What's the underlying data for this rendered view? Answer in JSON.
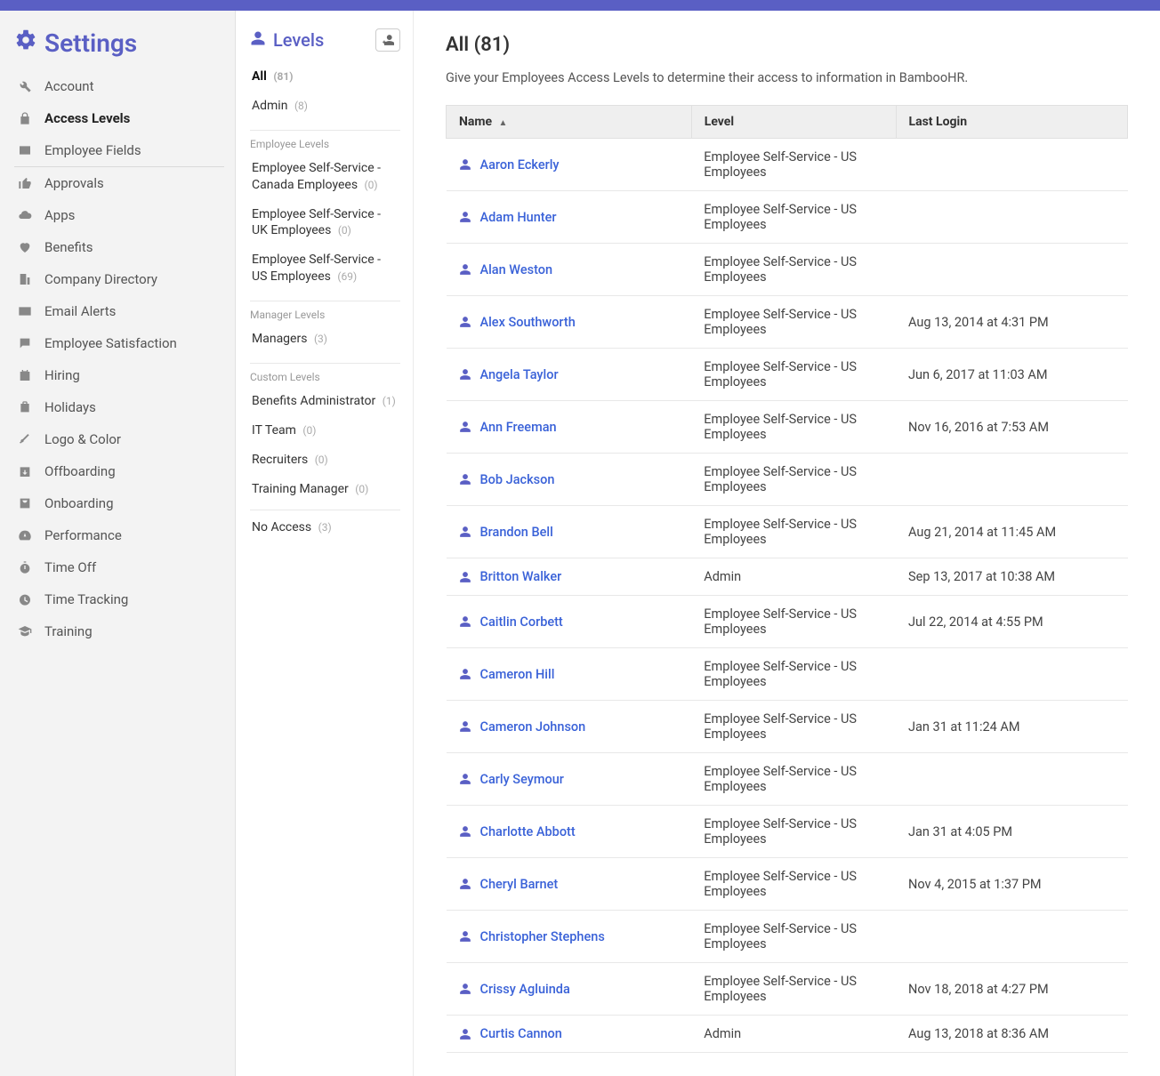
{
  "sidebar": {
    "title": "Settings",
    "items": [
      {
        "label": "Account",
        "icon": "wrench-icon"
      },
      {
        "label": "Access Levels",
        "icon": "lock-icon",
        "active": true
      },
      {
        "label": "Employee Fields",
        "icon": "id-card-icon"
      },
      {
        "label": "Approvals",
        "icon": "thumbs-up-icon",
        "borderTop": true
      },
      {
        "label": "Apps",
        "icon": "cloud-icon"
      },
      {
        "label": "Benefits",
        "icon": "heart-icon"
      },
      {
        "label": "Company Directory",
        "icon": "building-icon"
      },
      {
        "label": "Email Alerts",
        "icon": "mail-alert-icon"
      },
      {
        "label": "Employee Satisfaction",
        "icon": "chat-icon"
      },
      {
        "label": "Hiring",
        "icon": "clipboard-icon"
      },
      {
        "label": "Holidays",
        "icon": "luggage-icon"
      },
      {
        "label": "Logo & Color",
        "icon": "brush-icon"
      },
      {
        "label": "Offboarding",
        "icon": "calendar-out-icon"
      },
      {
        "label": "Onboarding",
        "icon": "badge-icon"
      },
      {
        "label": "Performance",
        "icon": "gauge-icon"
      },
      {
        "label": "Time Off",
        "icon": "stopwatch-icon"
      },
      {
        "label": "Time Tracking",
        "icon": "timer-icon"
      },
      {
        "label": "Training",
        "icon": "graduation-icon"
      }
    ]
  },
  "levels": {
    "title": "Levels",
    "top": [
      {
        "label": "All",
        "count": "(81)",
        "active": true
      },
      {
        "label": "Admin",
        "count": "(8)"
      }
    ],
    "sections": [
      {
        "title": "Employee Levels",
        "items": [
          {
            "label": "Employee Self-Service - Canada Employees",
            "count": "(0)"
          },
          {
            "label": "Employee Self-Service - UK Employees",
            "count": "(0)"
          },
          {
            "label": "Employee Self-Service - US Employees",
            "count": "(69)"
          }
        ]
      },
      {
        "title": "Manager Levels",
        "items": [
          {
            "label": "Managers",
            "count": "(3)"
          }
        ]
      },
      {
        "title": "Custom Levels",
        "items": [
          {
            "label": "Benefits Administrator",
            "count": "(1)"
          },
          {
            "label": "IT Team",
            "count": "(0)"
          },
          {
            "label": "Recruiters",
            "count": "(0)"
          },
          {
            "label": "Training Manager",
            "count": "(0)"
          }
        ]
      }
    ],
    "bottom": [
      {
        "label": "No Access",
        "count": "(3)"
      }
    ]
  },
  "main": {
    "title": "All (81)",
    "description": "Give your Employees Access Levels to determine their access to information in BambooHR.",
    "columns": {
      "name": "Name",
      "level": "Level",
      "lastLogin": "Last Login"
    },
    "rows": [
      {
        "name": "Aaron Eckerly",
        "level": "Employee Self-Service - US Employees",
        "lastLogin": ""
      },
      {
        "name": "Adam Hunter",
        "level": "Employee Self-Service - US Employees",
        "lastLogin": ""
      },
      {
        "name": "Alan Weston",
        "level": "Employee Self-Service - US Employees",
        "lastLogin": ""
      },
      {
        "name": "Alex Southworth",
        "level": "Employee Self-Service - US Employees",
        "lastLogin": "Aug 13, 2014 at 4:31 PM"
      },
      {
        "name": "Angela Taylor",
        "level": "Employee Self-Service - US Employees",
        "lastLogin": "Jun 6, 2017 at 11:03 AM"
      },
      {
        "name": "Ann Freeman",
        "level": "Employee Self-Service - US Employees",
        "lastLogin": "Nov 16, 2016 at 7:53 AM"
      },
      {
        "name": "Bob Jackson",
        "level": "Employee Self-Service - US Employees",
        "lastLogin": ""
      },
      {
        "name": "Brandon Bell",
        "level": "Employee Self-Service - US Employees",
        "lastLogin": "Aug 21, 2014 at 11:45 AM"
      },
      {
        "name": "Britton Walker",
        "level": "Admin",
        "lastLogin": "Sep 13, 2017 at 10:38 AM"
      },
      {
        "name": "Caitlin Corbett",
        "level": "Employee Self-Service - US Employees",
        "lastLogin": "Jul 22, 2014 at 4:55 PM"
      },
      {
        "name": "Cameron Hill",
        "level": "Employee Self-Service - US Employees",
        "lastLogin": ""
      },
      {
        "name": "Cameron Johnson",
        "level": "Employee Self-Service - US Employees",
        "lastLogin": "Jan 31 at 11:24 AM"
      },
      {
        "name": "Carly Seymour",
        "level": "Employee Self-Service - US Employees",
        "lastLogin": ""
      },
      {
        "name": "Charlotte Abbott",
        "level": "Employee Self-Service - US Employees",
        "lastLogin": "Jan 31 at 4:05 PM"
      },
      {
        "name": "Cheryl Barnet",
        "level": "Employee Self-Service - US Employees",
        "lastLogin": "Nov 4, 2015 at 1:37 PM"
      },
      {
        "name": "Christopher Stephens",
        "level": "Employee Self-Service - US Employees",
        "lastLogin": ""
      },
      {
        "name": "Crissy Agluinda",
        "level": "Employee Self-Service - US Employees",
        "lastLogin": "Nov 18, 2018 at 4:27 PM"
      },
      {
        "name": "Curtis Cannon",
        "level": "Admin",
        "lastLogin": "Aug 13, 2018 at 8:36 AM"
      }
    ]
  }
}
